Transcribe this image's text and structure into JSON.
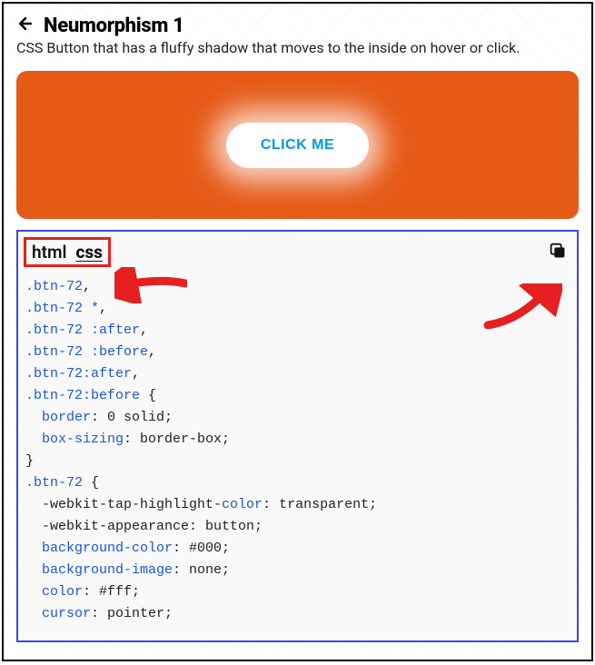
{
  "header": {
    "title": "Neumorphism 1",
    "subtitle": "CSS Button that has a fluffy shadow that moves to the inside on hover or click."
  },
  "preview": {
    "button_label": "CLICK ME",
    "bg_color": "#e65a17"
  },
  "tabs": {
    "items": [
      "html",
      "css"
    ],
    "active_index": 1
  },
  "code": {
    "lines": [
      {
        "t": "sel",
        "v": ".btn-72"
      },
      {
        "t": "punct",
        "v": ","
      },
      {
        "br": true
      },
      {
        "t": "sel",
        "v": ".btn-72 *"
      },
      {
        "t": "punct",
        "v": ","
      },
      {
        "br": true
      },
      {
        "t": "sel",
        "v": ".btn-72 :after"
      },
      {
        "t": "punct",
        "v": ","
      },
      {
        "br": true
      },
      {
        "t": "sel",
        "v": ".btn-72 :before"
      },
      {
        "t": "punct",
        "v": ","
      },
      {
        "br": true
      },
      {
        "t": "sel",
        "v": ".btn-72:after"
      },
      {
        "t": "punct",
        "v": ","
      },
      {
        "br": true
      },
      {
        "t": "sel",
        "v": ".btn-72:before"
      },
      {
        "t": "punct",
        "v": " {"
      },
      {
        "br": true
      },
      {
        "t": "punct",
        "v": "  "
      },
      {
        "t": "prop",
        "v": "border"
      },
      {
        "t": "punct",
        "v": ": 0 solid;"
      },
      {
        "br": true
      },
      {
        "t": "punct",
        "v": "  "
      },
      {
        "t": "prop",
        "v": "box-sizing"
      },
      {
        "t": "punct",
        "v": ": border-box;"
      },
      {
        "br": true
      },
      {
        "t": "punct",
        "v": "}"
      },
      {
        "br": true
      },
      {
        "t": "sel",
        "v": ".btn-72"
      },
      {
        "t": "punct",
        "v": " {"
      },
      {
        "br": true
      },
      {
        "t": "punct",
        "v": "  -webkit-tap-highlight-"
      },
      {
        "t": "prop",
        "v": "color"
      },
      {
        "t": "punct",
        "v": ": transparent;"
      },
      {
        "br": true
      },
      {
        "t": "punct",
        "v": "  -webkit-appearance: button;"
      },
      {
        "br": true
      },
      {
        "t": "punct",
        "v": "  "
      },
      {
        "t": "prop",
        "v": "background-color"
      },
      {
        "t": "punct",
        "v": ": #000;"
      },
      {
        "br": true
      },
      {
        "t": "punct",
        "v": "  "
      },
      {
        "t": "prop",
        "v": "background-image"
      },
      {
        "t": "punct",
        "v": ": none;"
      },
      {
        "br": true
      },
      {
        "t": "punct",
        "v": "  "
      },
      {
        "t": "prop",
        "v": "color"
      },
      {
        "t": "punct",
        "v": ": #fff;"
      },
      {
        "br": true
      },
      {
        "t": "punct",
        "v": "  "
      },
      {
        "t": "prop",
        "v": "cursor"
      },
      {
        "t": "punct",
        "v": ": pointer;"
      }
    ]
  }
}
